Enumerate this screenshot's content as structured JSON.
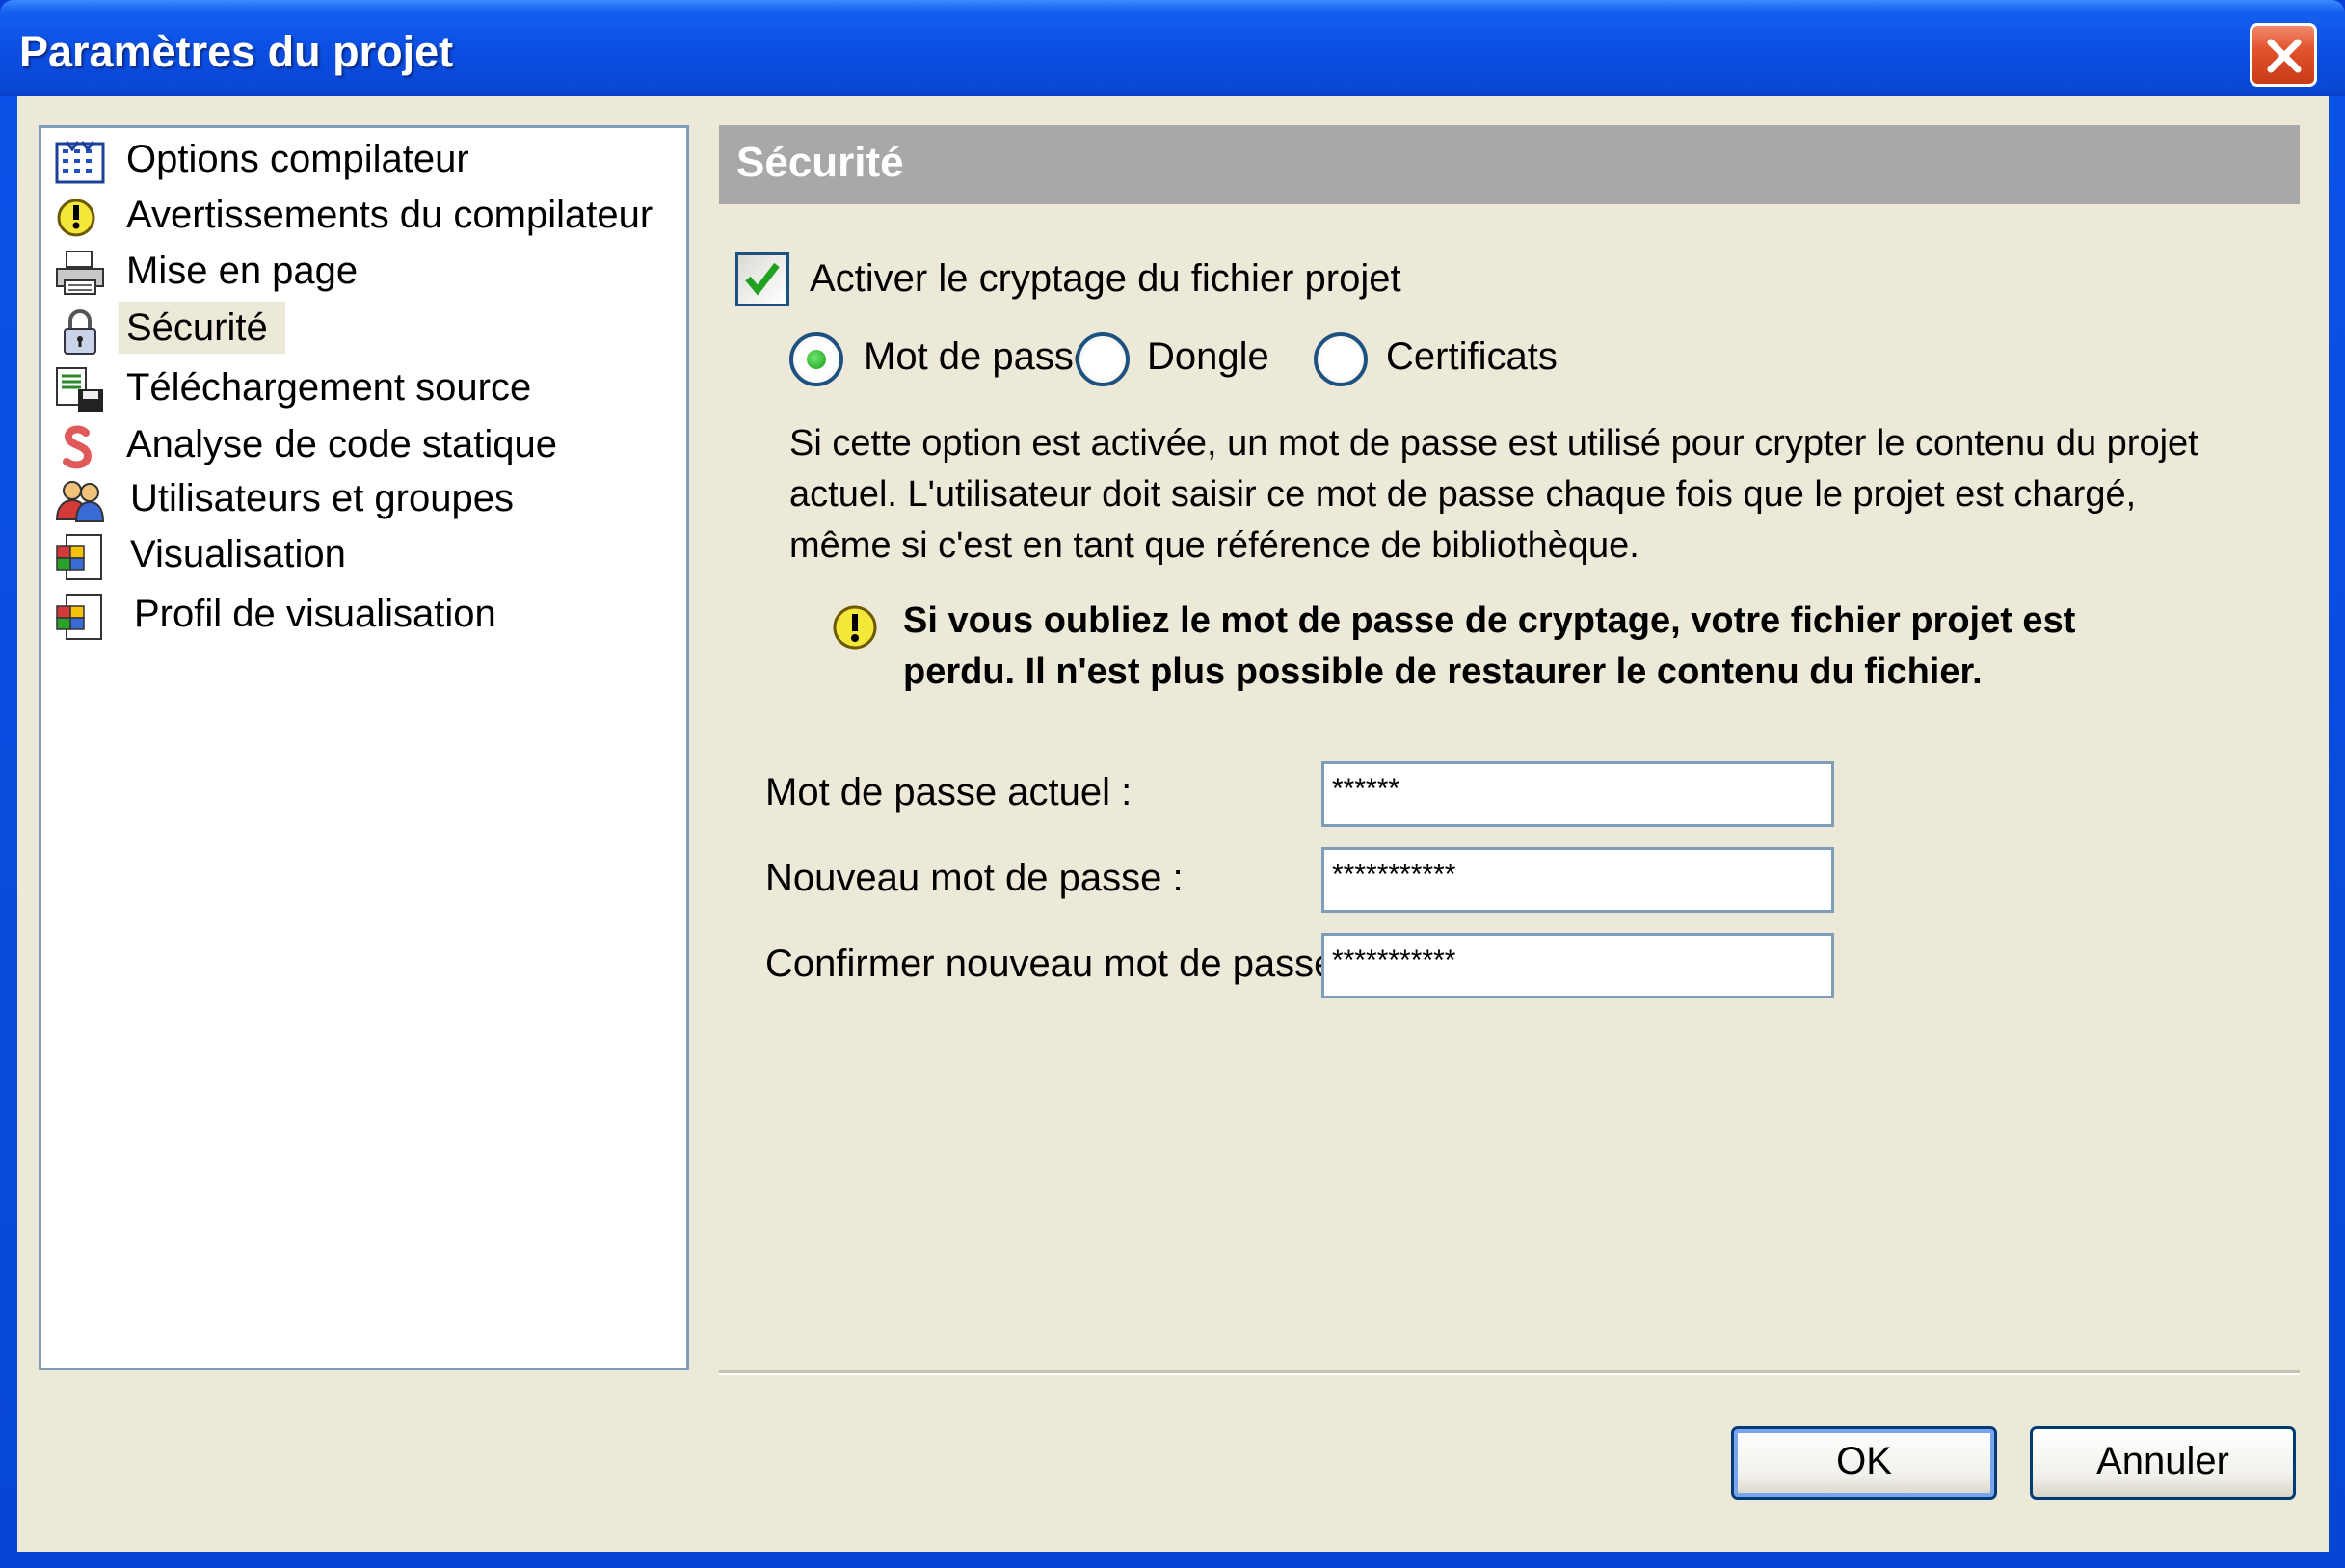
{
  "window": {
    "title": "Paramètres du projet"
  },
  "tree": {
    "items": [
      {
        "label": "Options compilateur",
        "icon": "compiler-options-icon"
      },
      {
        "label": "Avertissements du compilateur",
        "icon": "warning-icon"
      },
      {
        "label": "Mise en page",
        "icon": "printer-icon"
      },
      {
        "label": "Sécurité",
        "icon": "padlock-icon",
        "selected": true
      },
      {
        "label": "Téléchargement source",
        "icon": "source-download-icon"
      },
      {
        "label": "Analyse de code statique",
        "icon": "static-analysis-icon"
      },
      {
        "label": "Utilisateurs et groupes",
        "icon": "users-groups-icon"
      },
      {
        "label": "Visualisation",
        "icon": "visualization-icon"
      },
      {
        "label": "Profil de visualisation",
        "icon": "visualization-profile-icon"
      }
    ]
  },
  "panel": {
    "header": "Sécurité",
    "encrypt_checkbox": {
      "label": "Activer le cryptage du fichier projet",
      "checked": true
    },
    "radios": [
      {
        "label": "Mot de passe",
        "checked": true
      },
      {
        "label": "Dongle",
        "checked": false
      },
      {
        "label": "Certificats",
        "checked": false
      }
    ],
    "description": "Si cette option est activée, un mot de passe est utilisé pour crypter le contenu du projet actuel. L'utilisateur doit saisir ce mot de passe chaque fois que le projet est chargé, même si c'est en tant que référence de bibliothèque.",
    "warning": "Si vous oubliez le mot de passe de cryptage, votre fichier projet est perdu. Il n'est plus possible de restaurer le contenu du fichier.",
    "fields": [
      {
        "label": "Mot de passe actuel :",
        "value": "******"
      },
      {
        "label": "Nouveau mot de passe :",
        "value": "***********"
      },
      {
        "label": "Confirmer nouveau mot de passe :",
        "value": "***********"
      }
    ]
  },
  "buttons": {
    "ok": "OK",
    "cancel": "Annuler"
  },
  "colors": {
    "titlebar": "#0a47d6",
    "dialog_bg": "#ece9d8",
    "header_bg": "#a8a8a8",
    "border": "#7f9db9"
  }
}
